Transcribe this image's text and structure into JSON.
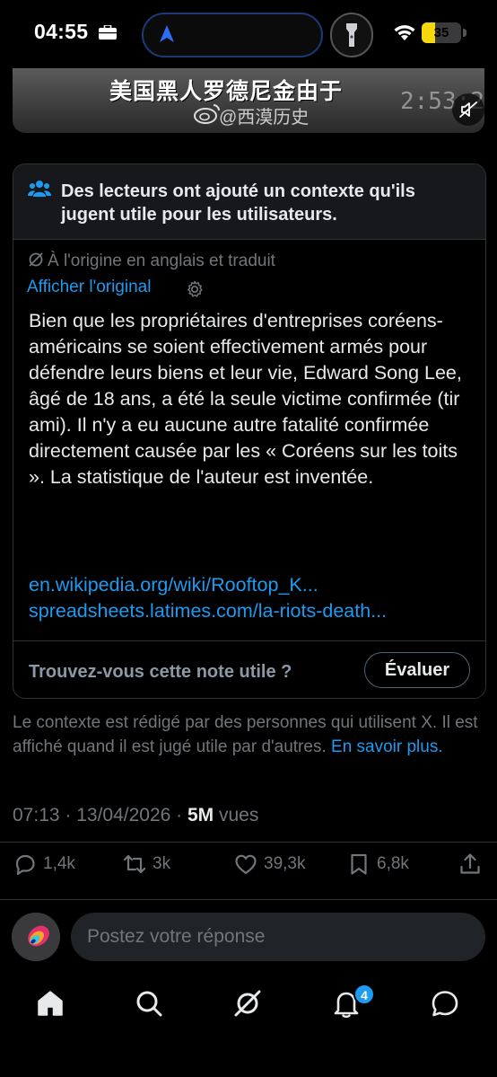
{
  "status_bar": {
    "time": "04:55",
    "battery": "35",
    "battery_percent": 35,
    "battery_color": "#f5d90a",
    "icons": [
      "briefcase-icon",
      "navigation-arrow-icon",
      "flashlight-icon",
      "wifi-icon"
    ]
  },
  "video": {
    "caption": "美国黑人罗德尼金由于",
    "timestamp": "2:53:26",
    "watermark": "@西漠历史",
    "mute_icon": "speaker-muted-icon"
  },
  "note": {
    "header": "Des lecteurs ont ajouté un contexte qu'ils jugent utile pour les utilisateurs.",
    "translated_label": "À l'origine en anglais et traduit",
    "show_original": "Afficher l'original",
    "body": "Bien que les propriétaires d'entreprises coréens-américains se soient effectivement armés pour défendre leurs biens et leur vie, Edward Song Lee, âgé de 18 ans, a été la seule victime confirmée (tir ami). Il n'y a eu aucune autre fatalité confirmée directement causée par les « Coréens sur les toits ». La statistique de l'auteur est inventée.",
    "links": [
      "en.wikipedia.org/wiki/Rooftop_K...",
      "spreadsheets.latimes.com/la-riots-death..."
    ],
    "helpful_question": "Trouvez-vous cette note utile ?",
    "rate_button": "Évaluer"
  },
  "disclaimer": {
    "text": "Le contexte est rédigé par des personnes qui utilisent X. Il est affiché quand il est jugé utile par d'autres. ",
    "learn_more": "En savoir plus."
  },
  "meta": {
    "timestamp": "07:13 · 13/04/2026 · ",
    "views": "5M",
    "views_label": " vues"
  },
  "actions": {
    "replies": "1,4k",
    "reposts": "3k",
    "likes": "39,3k",
    "bookmarks": "6,8k"
  },
  "composer": {
    "placeholder": "Postez votre réponse"
  },
  "bottom_nav": {
    "items": [
      "home-icon",
      "search-icon",
      "grok-icon",
      "notifications-icon",
      "messages-icon"
    ],
    "notifications_badge": "4"
  },
  "colors": {
    "accent": "#1d9bf0",
    "muted": "#71767b",
    "text": "#e7e9ea",
    "border": "#2f3336"
  }
}
